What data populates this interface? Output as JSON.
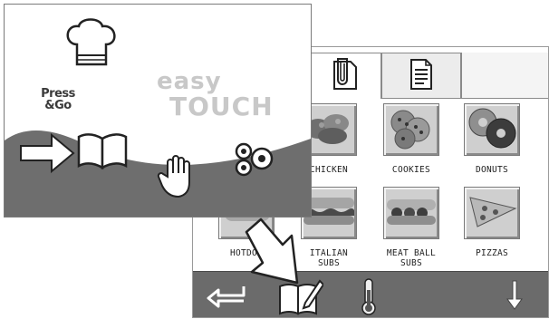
{
  "back_screen": {
    "tabs": [
      {
        "icon": "document-clip-icon",
        "active": true
      },
      {
        "icon": "document-list-icon",
        "active": false
      }
    ],
    "recipes": [
      {
        "label": "CHICKEN",
        "icon": "chicken-photo"
      },
      {
        "label": "COOKIES",
        "icon": "cookies-photo"
      },
      {
        "label": "DONUTS",
        "icon": "donuts-photo"
      },
      {
        "label": "HOTDOG",
        "icon": "hotdog-photo"
      },
      {
        "label": "ITALIAN SUBS",
        "icon": "italian-subs-photo"
      },
      {
        "label": "MEAT BALL SUBS",
        "icon": "meatball-subs-photo"
      },
      {
        "label": "PIZZAS",
        "icon": "pizza-photo"
      }
    ],
    "toolbar": [
      "back-arrow-icon",
      "recipe-book-edit-icon",
      "thermometer-icon",
      "down-arrow-icon"
    ]
  },
  "front_screen": {
    "brand_line1": "easy",
    "brand_line2": "TOUCH",
    "press_go_line1": "Press",
    "press_go_line2": "&Go",
    "icons": [
      "chef-hat-icon",
      "open-book-icon",
      "hand-icon",
      "gear-pair-icon"
    ],
    "colors": {
      "wave": "#6e6e6e",
      "brand": "#c8c8c8"
    }
  }
}
